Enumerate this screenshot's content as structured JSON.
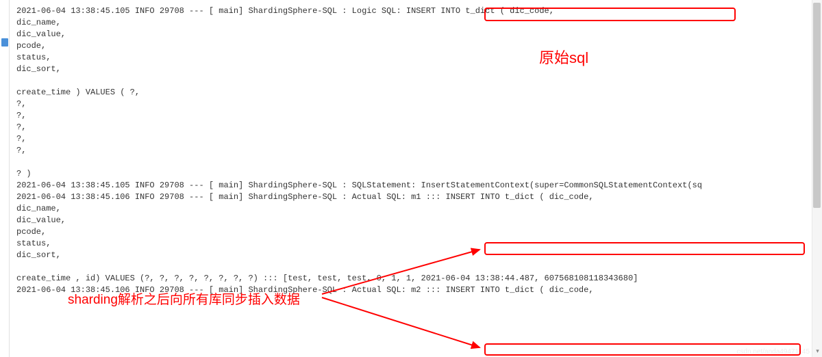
{
  "console": {
    "lines": [
      "2021-06-04 13:38:45.105  INFO 29708 --- [           main] ShardingSphere-SQL                       : Logic SQL: INSERT INTO t_dict  ( dic_code,",
      "dic_name,",
      "dic_value,",
      "pcode,",
      "status,",
      "dic_sort,",
      "",
      "create_time )  VALUES  ( ?,",
      "?,",
      "?,",
      "?,",
      "?,",
      "?,",
      "",
      "? )",
      "2021-06-04 13:38:45.105  INFO 29708 --- [           main] ShardingSphere-SQL                       : SQLStatement: InsertStatementContext(super=CommonSQLStatementContext(sq",
      "2021-06-04 13:38:45.106  INFO 29708 --- [           main] ShardingSphere-SQL                       : Actual SQL: m1 ::: INSERT INTO t_dict  ( dic_code,",
      "dic_name,",
      "dic_value,",
      "pcode,",
      "status,",
      "dic_sort,",
      "",
      "create_time , id)  VALUES  (?, ?, ?, ?, ?, ?, ?, ?) ::: [test, test, test, 0, 1, 1, 2021-06-04 13:38:44.487, 607568108118343680]",
      "2021-06-04 13:38:45.106  INFO 29708 --- [           main] ShardingSphere-SQL                       : Actual SQL: m2 ::: INSERT INTO t_dict  ( dic_code,"
    ]
  },
  "annotations": {
    "label1": "原始sql",
    "label2": "sharding解析之后向所有库同步插入数据"
  },
  "watermark": "csdn.net/anda49471145"
}
